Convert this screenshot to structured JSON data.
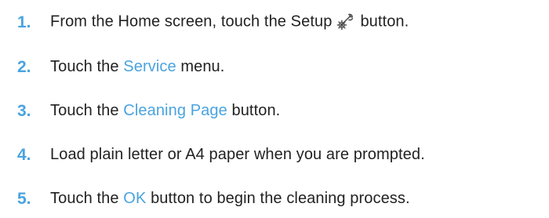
{
  "steps": [
    {
      "number": "1.",
      "text_before": "From the Home screen, touch the Setup",
      "icon": "setup-wrench-gear-icon",
      "text_after": "button."
    },
    {
      "number": "2.",
      "text_before": "Touch the ",
      "ui_term": "Service",
      "text_after": " menu."
    },
    {
      "number": "3.",
      "text_before": "Touch the ",
      "ui_term": "Cleaning Page",
      "text_after": " button."
    },
    {
      "number": "4.",
      "text": "Load plain letter or A4 paper when you are prompted."
    },
    {
      "number": "5.",
      "text_before": "Touch the ",
      "ui_term": "OK",
      "text_after": " button to begin the cleaning process."
    }
  ],
  "colors": {
    "step_number": "#4aa3df",
    "ui_term": "#4aa3df",
    "body_text": "#222222"
  }
}
